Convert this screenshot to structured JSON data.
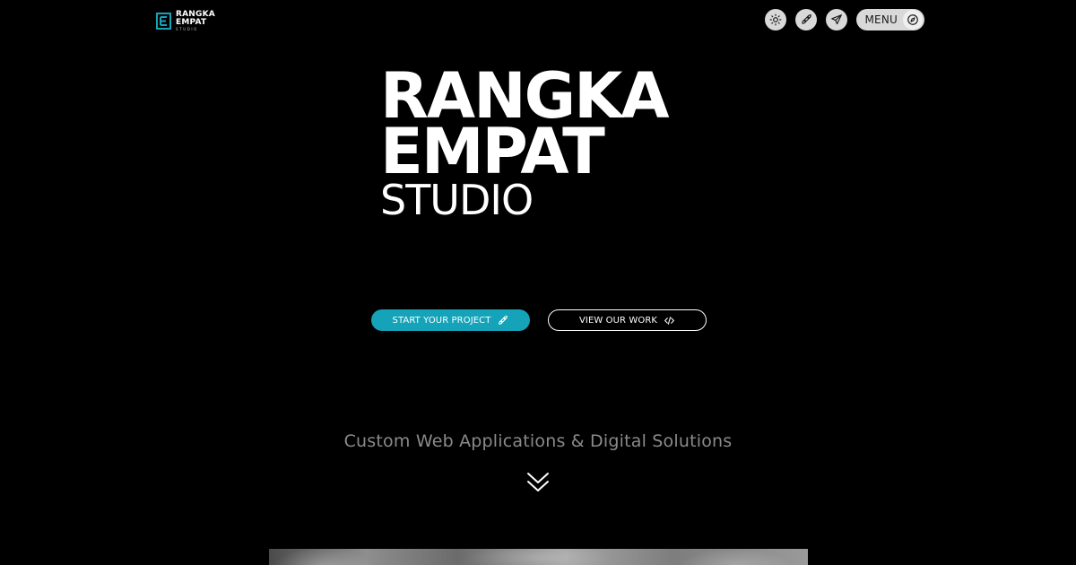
{
  "header": {
    "logo": {
      "line1": "RANGKA",
      "line2": "EMPAT",
      "sub": "STUDIO",
      "icon": "rangka-e-logo-icon"
    },
    "nav": {
      "theme_icon": "sun-icon",
      "launch_icon": "rocket-icon",
      "contact_icon": "paper-plane-icon",
      "menu_label": "MENU",
      "menu_icon": "compass-icon"
    }
  },
  "hero": {
    "title_line1": "RANGKA",
    "title_line2": "EMPAT",
    "title_line3": "STUDIO",
    "primary_cta": {
      "label": "START YOUR PROJECT",
      "icon": "rocket-icon"
    },
    "secondary_cta": {
      "label": "VIEW OUR WORK",
      "icon": "code-icon"
    },
    "tagline": "Custom Web Applications & Digital Solutions",
    "scroll_icon": "double-chevron-down-icon"
  },
  "colors": {
    "background": "#000000",
    "accent": "#14a3b8",
    "text": "#ffffff",
    "muted_text": "#8a8a8a",
    "nav_button": "#d9d9d9"
  }
}
